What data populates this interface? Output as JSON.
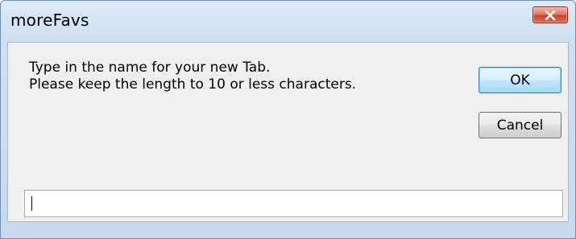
{
  "window": {
    "title": "moreFavs",
    "close_icon": "close-icon"
  },
  "dialog": {
    "message_line1": "Type in the name for your new Tab.",
    "message_line2": "Please keep the length to 10 or less characters.",
    "ok_label": "OK",
    "cancel_label": "Cancel",
    "input_value": "",
    "input_placeholder": ""
  },
  "colors": {
    "close_button": "#d86b4f",
    "ok_focus_border": "#3c7fb1"
  }
}
